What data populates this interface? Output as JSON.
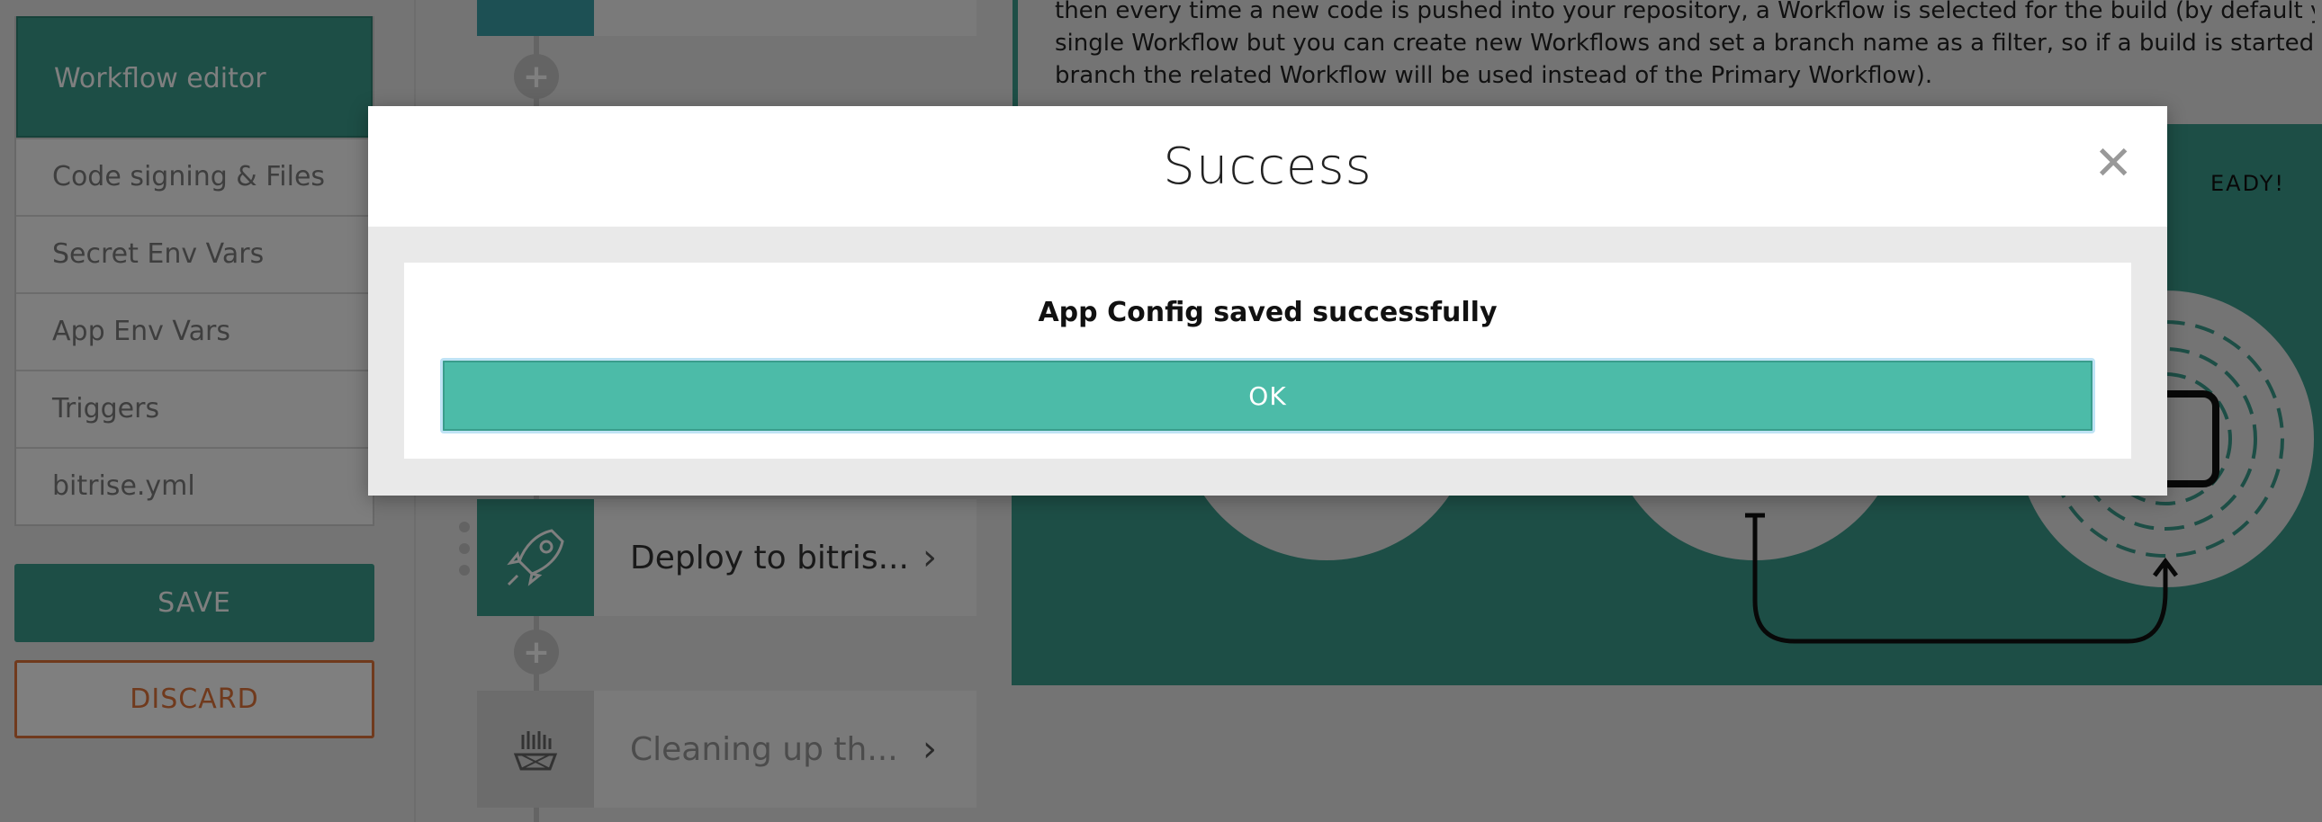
{
  "sidebar": {
    "active_item": "Workflow editor",
    "items": [
      {
        "label": "Code signing & Files"
      },
      {
        "label": "Secret Env Vars"
      },
      {
        "label": "App Env Vars"
      },
      {
        "label": "Triggers"
      },
      {
        "label": "bitrise.yml"
      }
    ],
    "save_label": "SAVE",
    "discard_label": "DISCARD"
  },
  "workflow": {
    "steps": [
      {
        "title": "Deploy to bitris...",
        "icon": "rocket-icon"
      },
      {
        "title": "Cleaning up th...",
        "icon": "cleanup-icon"
      }
    ]
  },
  "info": {
    "lines": [
      "then every time a new code is pushed into your repository, a Workflow is selected for the build (by default you",
      "single Workflow but you can create new Workflows and set a branch name as a filter, so if a build is started on t",
      "branch the related Workflow will be used instead of the Primary Workflow)."
    ],
    "illustration_text": "EADY!"
  },
  "modal": {
    "title": "Success",
    "message": "App Config saved successfully",
    "ok_label": "OK",
    "close_icon": "close-icon"
  },
  "colors": {
    "accent": "#3a9d8c",
    "ok_button": "#4cbba8",
    "discard": "#e0743a"
  }
}
